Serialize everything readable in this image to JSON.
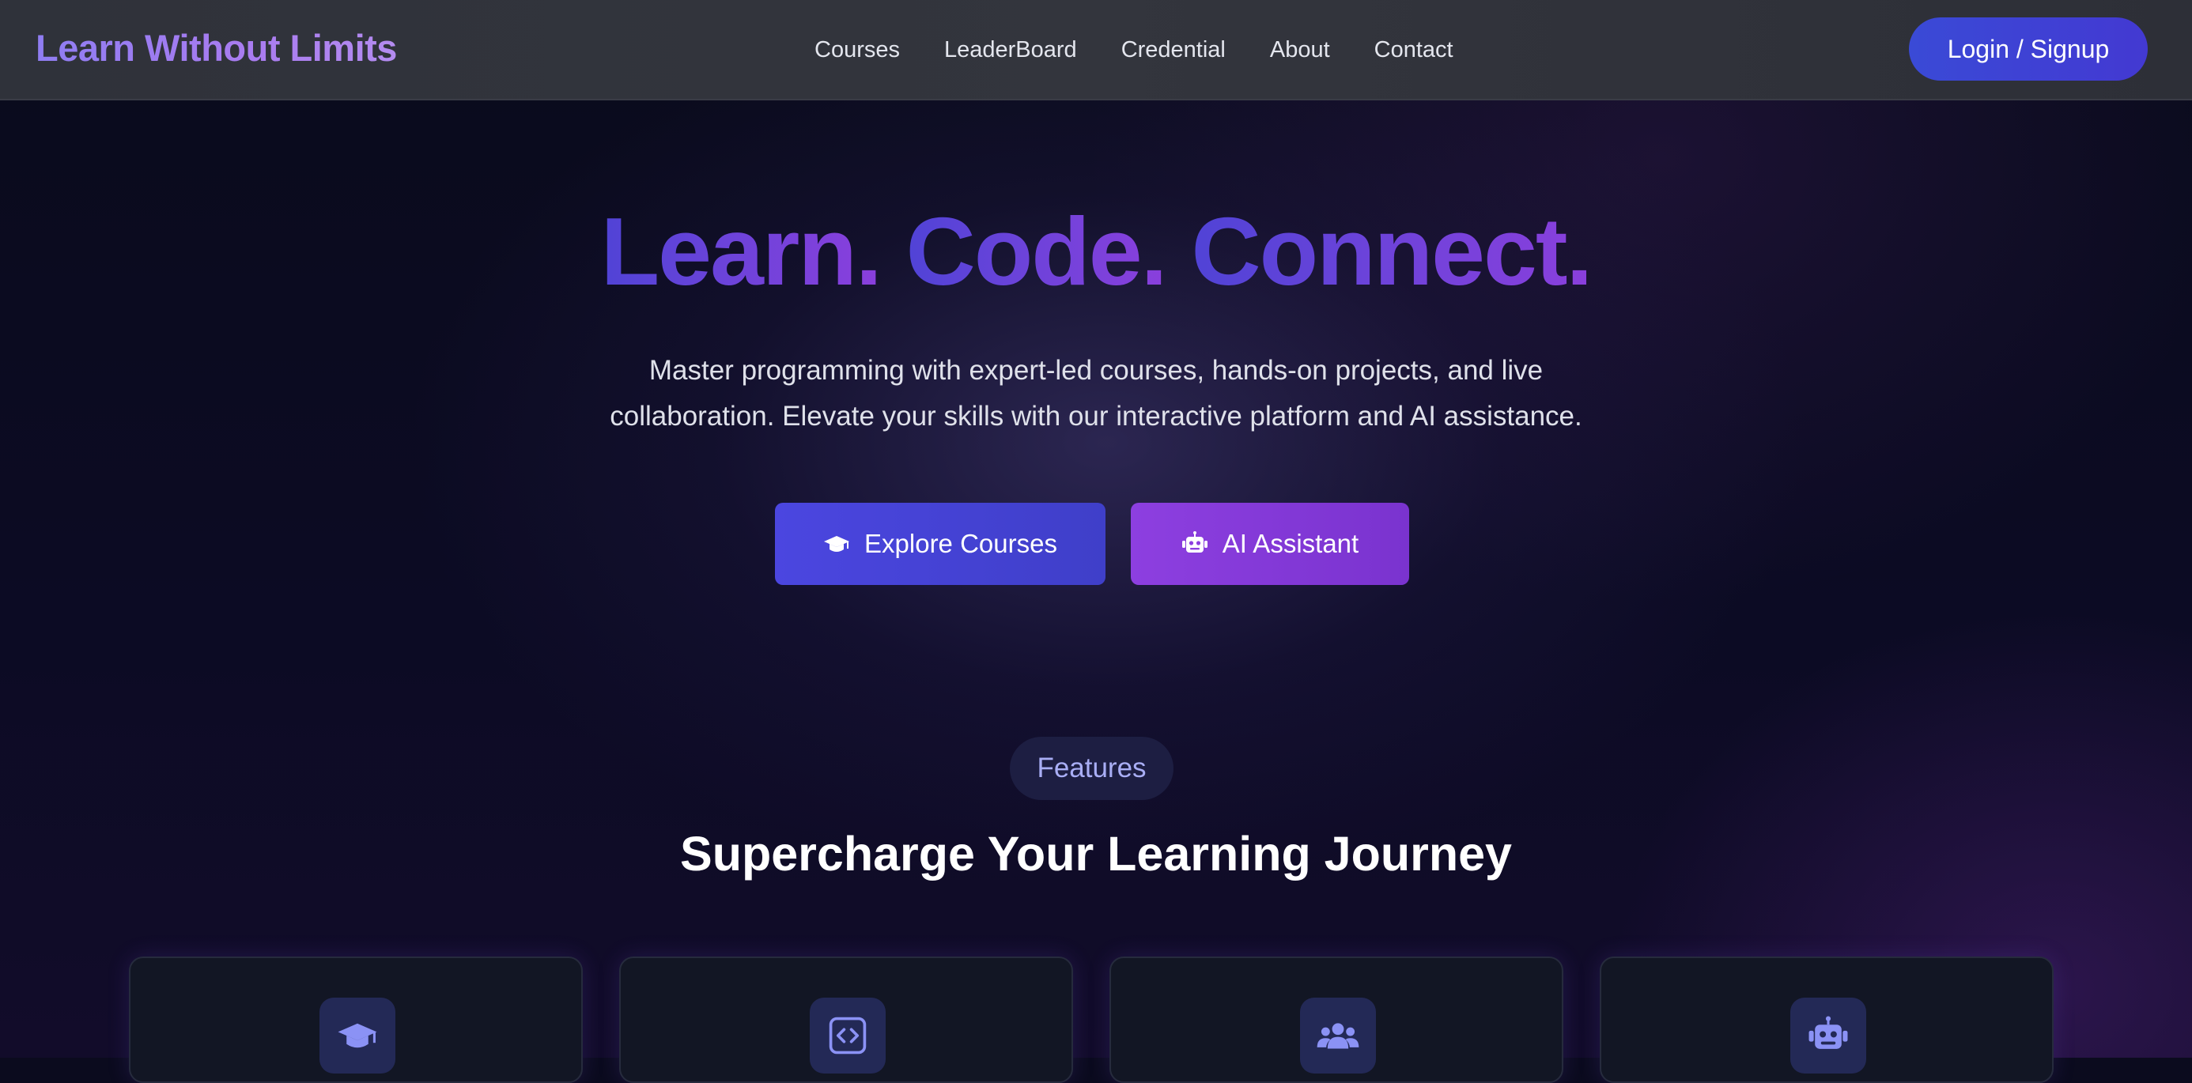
{
  "navbar": {
    "logo": "Learn Without Limits",
    "links": [
      "Courses",
      "LeaderBoard",
      "Credential",
      "About",
      "Contact"
    ],
    "login_label": "Login / Signup"
  },
  "hero": {
    "title_parts": [
      "Learn.",
      "Code.",
      "Connect."
    ],
    "subtitle_line1": "Master programming with expert-led courses, hands-on projects, and live",
    "subtitle_line2": "collaboration. Elevate your skills with our interactive platform and AI assistance.",
    "explore_label": "Explore Courses",
    "explore_icon": "graduation-cap-icon",
    "ai_label": "AI Assistant",
    "ai_icon": "robot-icon"
  },
  "features": {
    "badge": "Features",
    "title": "Supercharge Your Learning Journey",
    "cards": [
      {
        "icon": "graduation-cap-icon"
      },
      {
        "icon": "code-icon"
      },
      {
        "icon": "users-icon"
      },
      {
        "icon": "robot-icon"
      }
    ]
  },
  "colors": {
    "accent_indigo": "#4b46e0",
    "accent_purple": "#8d3fe0",
    "badge_text": "#a9aef5",
    "icon_color": "#8b92f5"
  }
}
